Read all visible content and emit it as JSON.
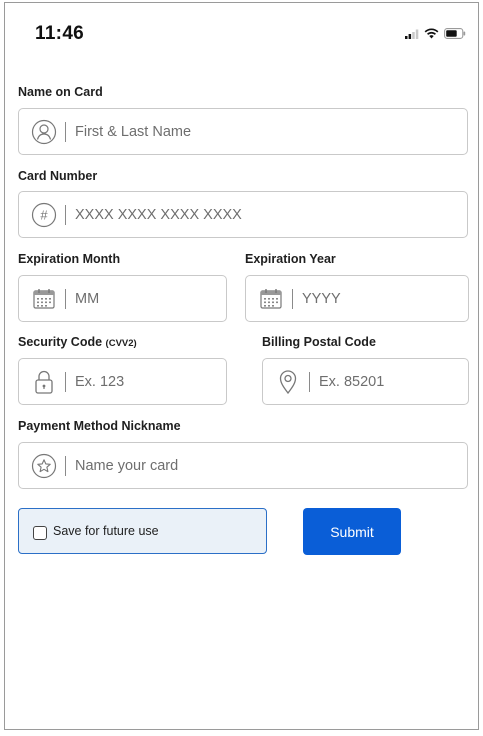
{
  "status_bar": {
    "time": "11:46"
  },
  "form": {
    "name_on_card": {
      "label": "Name on Card",
      "placeholder": "First & Last Name",
      "icon": "user-circle-icon"
    },
    "card_number": {
      "label": "Card Number",
      "placeholder": "XXXX XXXX XXXX XXXX",
      "icon": "hash-circle-icon"
    },
    "expiration_month": {
      "label": "Expiration Month",
      "placeholder": "MM",
      "icon": "calendar-icon"
    },
    "expiration_year": {
      "label": "Expiration Year",
      "placeholder": "YYYY",
      "icon": "calendar-icon"
    },
    "security_code": {
      "label": "Security Code",
      "label_suffix": "(CVV2)",
      "placeholder": "Ex. 123",
      "icon": "lock-icon"
    },
    "billing_postal_code": {
      "label": "Billing Postal Code",
      "placeholder": "Ex. 85201",
      "icon": "location-pin-icon"
    },
    "nickname": {
      "label": "Payment Method Nickname",
      "placeholder": "Name your card",
      "icon": "star-circle-icon"
    },
    "save_for_future": {
      "label": "Save for future use",
      "checked": false
    },
    "submit_label": "Submit"
  },
  "colors": {
    "primary": "#0a5ed7",
    "save_box_bg": "#eaf1f8",
    "save_box_border": "#2b6fc7",
    "field_border": "#c9c9c9"
  }
}
